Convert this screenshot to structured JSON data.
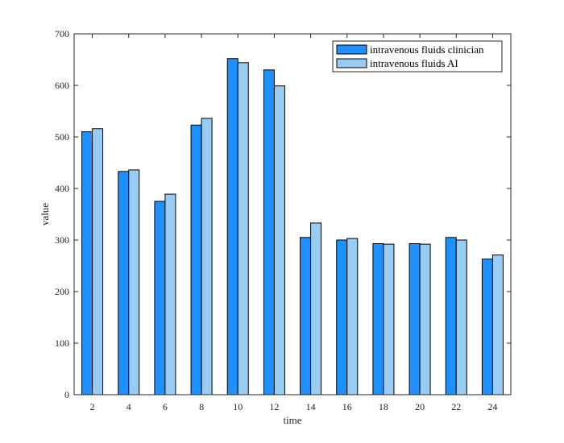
{
  "chart_data": {
    "type": "bar",
    "categories": [
      "2",
      "4",
      "6",
      "8",
      "10",
      "12",
      "14",
      "16",
      "18",
      "20",
      "22",
      "24"
    ],
    "series": [
      {
        "name": "intravenous fluids clinician",
        "color": "#1E90FF",
        "values": [
          510,
          433,
          375,
          523,
          652,
          630,
          305,
          300,
          293,
          293,
          305,
          263
        ]
      },
      {
        "name": "intravenous fluids AI",
        "color": "#99CCF2",
        "values": [
          516,
          436,
          389,
          536,
          644,
          599,
          333,
          303,
          292,
          292,
          300,
          271
        ]
      }
    ],
    "xlabel": "time",
    "ylabel": "value",
    "ylim": [
      0,
      700
    ],
    "yticks": [
      0,
      100,
      200,
      300,
      400,
      500,
      600,
      700
    ],
    "grid": false,
    "legend_position": "top-right"
  }
}
